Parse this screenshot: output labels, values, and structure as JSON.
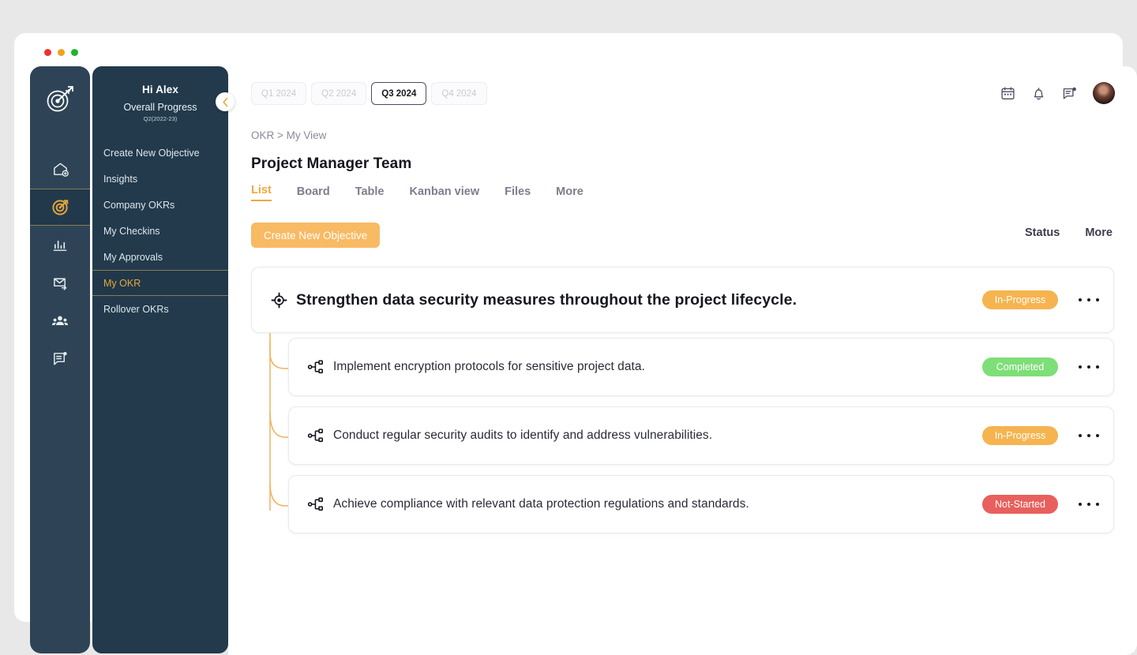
{
  "window": {
    "chrome_dots": [
      "#f0322c",
      "#f0a11c",
      "#1cb62c"
    ]
  },
  "colors": {
    "accent": "#eda93f",
    "rail_bg": "#2e4456",
    "panel_bg": "#223a4c",
    "status_in_progress": "#f5b44f",
    "status_completed": "#7ede78",
    "status_not_started": "#e8605d",
    "tree_line": "#edb45f"
  },
  "rail": {
    "logo_icon": "target-arrow-logo",
    "items": [
      {
        "icon": "home-add-icon",
        "name": "home",
        "active": false
      },
      {
        "icon": "target-icon",
        "name": "okr",
        "active": true
      },
      {
        "icon": "bar-chart-icon",
        "name": "analytics",
        "active": false
      },
      {
        "icon": "mail-send-icon",
        "name": "messages",
        "active": false
      },
      {
        "icon": "people-group-icon",
        "name": "teams",
        "active": false
      },
      {
        "icon": "document-chat-icon",
        "name": "reports",
        "active": false
      }
    ]
  },
  "sidebar": {
    "greeting": "Hi Alex",
    "progress_label": "Overall Progress",
    "progress_period": "Q2(2022-23)",
    "collapse_icon": "chevron-left-icon",
    "items": [
      {
        "label": "Create New Objective",
        "active": false
      },
      {
        "label": "Insights",
        "active": false
      },
      {
        "label": "Company OKRs",
        "active": false
      },
      {
        "label": "My  Checkins",
        "active": false
      },
      {
        "label": "My Approvals",
        "active": false
      },
      {
        "label": "My OKR",
        "active": true
      },
      {
        "label": "Rollover OKRs",
        "active": false
      }
    ]
  },
  "topbar": {
    "quarters": [
      {
        "label": "Q1 2024",
        "selected": false
      },
      {
        "label": "Q2 2024",
        "selected": false
      },
      {
        "label": "Q3 2024",
        "selected": true
      },
      {
        "label": "Q4 2024",
        "selected": false
      }
    ],
    "actions": [
      {
        "icon": "calendar-icon",
        "name": "calendar"
      },
      {
        "icon": "bell-icon",
        "name": "notifications"
      },
      {
        "icon": "message-badge-icon",
        "name": "messages"
      }
    ],
    "avatar": "user-avatar"
  },
  "page": {
    "breadcrumb": "OKR > My View",
    "title": "Project Manager Team",
    "tabs": [
      {
        "label": "List",
        "active": true
      },
      {
        "label": "Board",
        "active": false
      },
      {
        "label": "Table",
        "active": false
      },
      {
        "label": "Kanban view",
        "active": false
      },
      {
        "label": "Files",
        "active": false
      },
      {
        "label": "More",
        "active": false
      }
    ]
  },
  "actions": {
    "create_objective_label": "Create New Objective",
    "column_headers": [
      "Status",
      "More"
    ]
  },
  "okr": {
    "objective": {
      "icon": "crosshair-target-icon",
      "text": "Strengthen data security measures throughout the project lifecycle.",
      "status": "In-Progress",
      "status_color": "#f5b44f",
      "more_icon": "more-horizontal-icon"
    },
    "key_results": [
      {
        "icon": "hierarchy-icon",
        "text": "Implement encryption protocols for sensitive project data.",
        "status": "Completed",
        "status_color": "#7ede78",
        "more_icon": "more-horizontal-icon"
      },
      {
        "icon": "hierarchy-icon",
        "text": "Conduct regular security audits to identify and address vulnerabilities.",
        "status": "In-Progress",
        "status_color": "#f5b44f",
        "more_icon": "more-horizontal-icon"
      },
      {
        "icon": "hierarchy-icon",
        "text": "Achieve compliance with relevant data protection regulations and standards.",
        "status": "Not-Started",
        "status_color": "#e8605d",
        "more_icon": "more-horizontal-icon"
      }
    ]
  }
}
